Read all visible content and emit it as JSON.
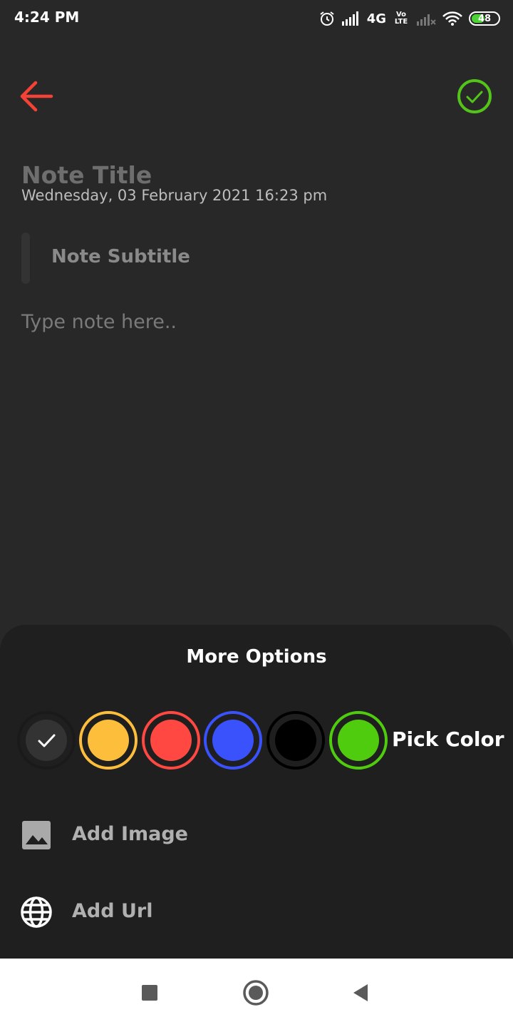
{
  "status_bar": {
    "time": "4:24 PM",
    "network": "4G",
    "volte": "Vo LTE",
    "battery": "48",
    "icons": [
      "alarm-icon",
      "signal-icon",
      "volte-icon",
      "signal-weak-icon",
      "wifi-icon",
      "battery-icon"
    ]
  },
  "toolbar": {
    "back_icon": "arrow-left-icon",
    "done_icon": "check-circle-icon",
    "back_color": "#f44336",
    "done_color": "#52c41a"
  },
  "note": {
    "title_placeholder": "Note Title",
    "date": "Wednesday, 03 February 2021 16:23 pm",
    "subtitle_placeholder": "Note Subtitle",
    "body_placeholder": "Type note here.."
  },
  "options": {
    "title": "More Options",
    "pick_color_label": "Pick Color",
    "colors": [
      {
        "name": "default",
        "fill": "#333333",
        "ring": "#1a1a1a",
        "selected": true
      },
      {
        "name": "yellow",
        "fill": "#fdbe3b",
        "ring": "#fdbe3b",
        "selected": false
      },
      {
        "name": "red",
        "fill": "#ff4842",
        "ring": "#ff4842",
        "selected": false
      },
      {
        "name": "blue",
        "fill": "#3a52fc",
        "ring": "#3a52fc",
        "selected": false
      },
      {
        "name": "black",
        "fill": "#000000",
        "ring": "#000000",
        "selected": false
      },
      {
        "name": "green",
        "fill": "#4fcc0e",
        "ring": "#4fcc0e",
        "selected": false
      }
    ],
    "add_image": {
      "label": "Add Image",
      "icon": "image-icon"
    },
    "add_url": {
      "label": "Add Url",
      "icon": "globe-icon"
    }
  },
  "nav_bar": {
    "buttons": [
      "recents-button",
      "home-button",
      "back-button"
    ]
  }
}
